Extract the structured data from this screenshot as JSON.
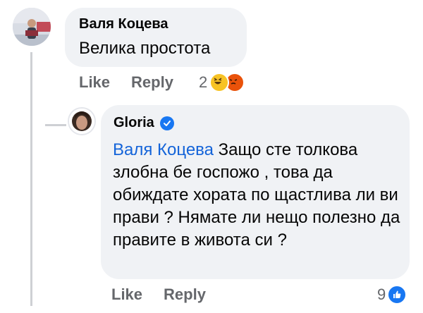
{
  "comment": {
    "author": "Валя Коцева",
    "text": "Велика простота",
    "actions": {
      "like_label": "Like",
      "reply_label": "Reply"
    },
    "reactions": {
      "count": "2",
      "icons": [
        "haha-emoji-icon",
        "angry-emoji-icon"
      ]
    }
  },
  "reply": {
    "author": "Gloria",
    "verified": true,
    "mention": "Валя Коцева",
    "text": " Защо сте толкова злобна бе госпожо , това да обиждате хората по щастлива ли ви прави ? Нямате ли нещо полезно да правите в живота си ?",
    "actions": {
      "like_label": "Like",
      "reply_label": "Reply"
    },
    "reactions": {
      "count": "9",
      "icons": [
        "like-reaction-icon"
      ]
    }
  },
  "colors": {
    "bubble_bg": "#f0f2f5",
    "mention_blue": "#1464d9",
    "meta_gray": "#65676b",
    "verified_blue": "#1877f2"
  }
}
